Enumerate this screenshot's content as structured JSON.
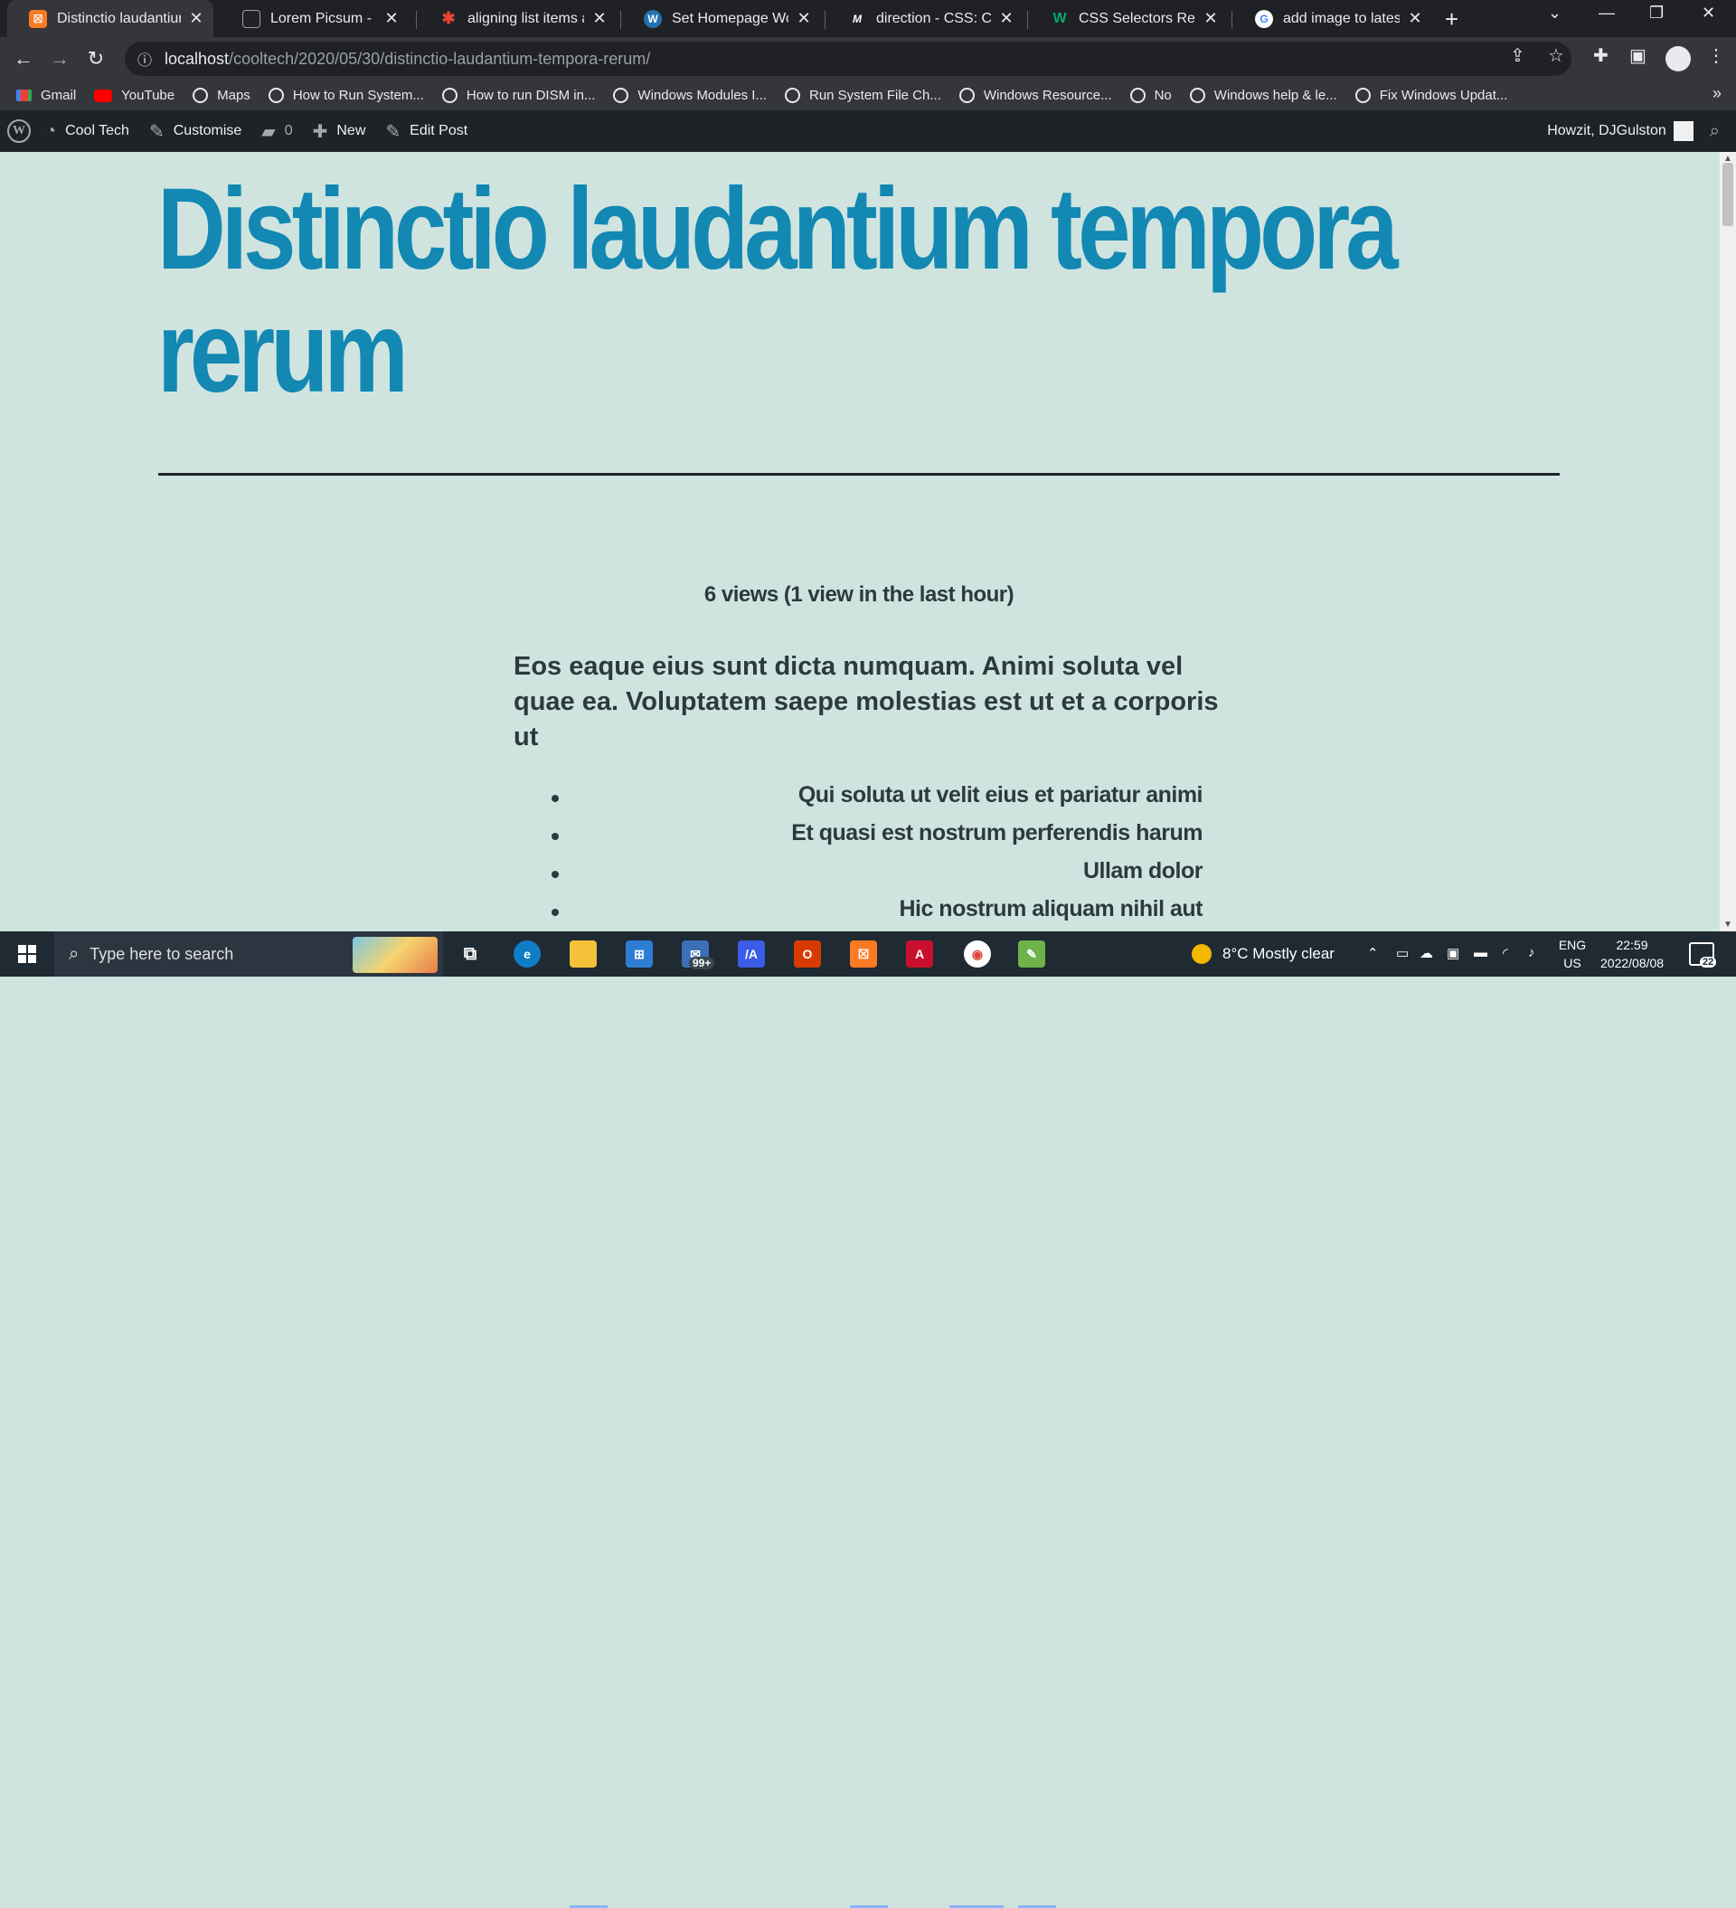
{
  "browser": {
    "tabs": [
      {
        "title": "Distinctio laudantium",
        "fav_color": "#fb7a24",
        "fav_text": "☒"
      },
      {
        "title": "Lorem Picsum - Image",
        "fav_color": "#202124",
        "fav_text": "▭"
      },
      {
        "title": "aligning list items and",
        "fav_color": "#202124",
        "fav_text": "✱"
      },
      {
        "title": "Set Homepage WordP",
        "fav_color": "#2271b1",
        "fav_text": "W"
      },
      {
        "title": "direction - CSS: Casca",
        "fav_color": "#202124",
        "fav_text": "M"
      },
      {
        "title": "CSS Selectors Referen",
        "fav_color": "#202124",
        "fav_text": "W"
      },
      {
        "title": "add image to latest p",
        "fav_color": "#ffffff",
        "fav_text": "G"
      }
    ],
    "url_host": "localhost",
    "url_path": "/cooltech/2020/05/30/distinctio-laudantium-tempora-rerum/",
    "bookmarks": [
      {
        "label": "Gmail",
        "icon": "gmail-icon"
      },
      {
        "label": "YouTube",
        "icon": "youtube-icon"
      },
      {
        "label": "Maps",
        "icon": "globe-icon"
      },
      {
        "label": "How to Run System...",
        "icon": "globe-icon"
      },
      {
        "label": "How to run DISM in...",
        "icon": "globe-icon"
      },
      {
        "label": "Windows Modules I...",
        "icon": "globe-icon"
      },
      {
        "label": "Run System File Ch...",
        "icon": "globe-icon"
      },
      {
        "label": "Windows Resource...",
        "icon": "globe-icon"
      },
      {
        "label": "No",
        "icon": "globe-icon"
      },
      {
        "label": "Windows help & le...",
        "icon": "globe-icon"
      },
      {
        "label": "Fix Windows Updat...",
        "icon": "globe-icon"
      }
    ]
  },
  "wp_admin": {
    "site_name": "Cool Tech",
    "customise": "Customise",
    "comments": "0",
    "new": "New",
    "edit_post": "Edit Post",
    "greeting": "Howzit, DJGulston"
  },
  "post": {
    "title": "Distinctio laudantium tempora rerum",
    "views": "6 views (1 view in the last hour)",
    "lead": "Eos eaque eius sunt dicta numquam. Animi soluta vel quae ea. Voluptatem saepe molestias est ut et a corporis ut",
    "items": [
      "Qui soluta ut velit eius et pariatur animi",
      "Et quasi est nostrum perferendis harum",
      "Ullam dolor",
      "Hic nostrum aliquam nihil aut"
    ],
    "title_color": "#1288b3"
  },
  "taskbar": {
    "search_placeholder": "Type here to search",
    "mail_badge": "99+",
    "weather": "8°C  Mostly clear",
    "lang_line1": "ENG",
    "lang_line2": "US",
    "time": "22:59",
    "date": "2022/08/08",
    "notifications": "22"
  }
}
